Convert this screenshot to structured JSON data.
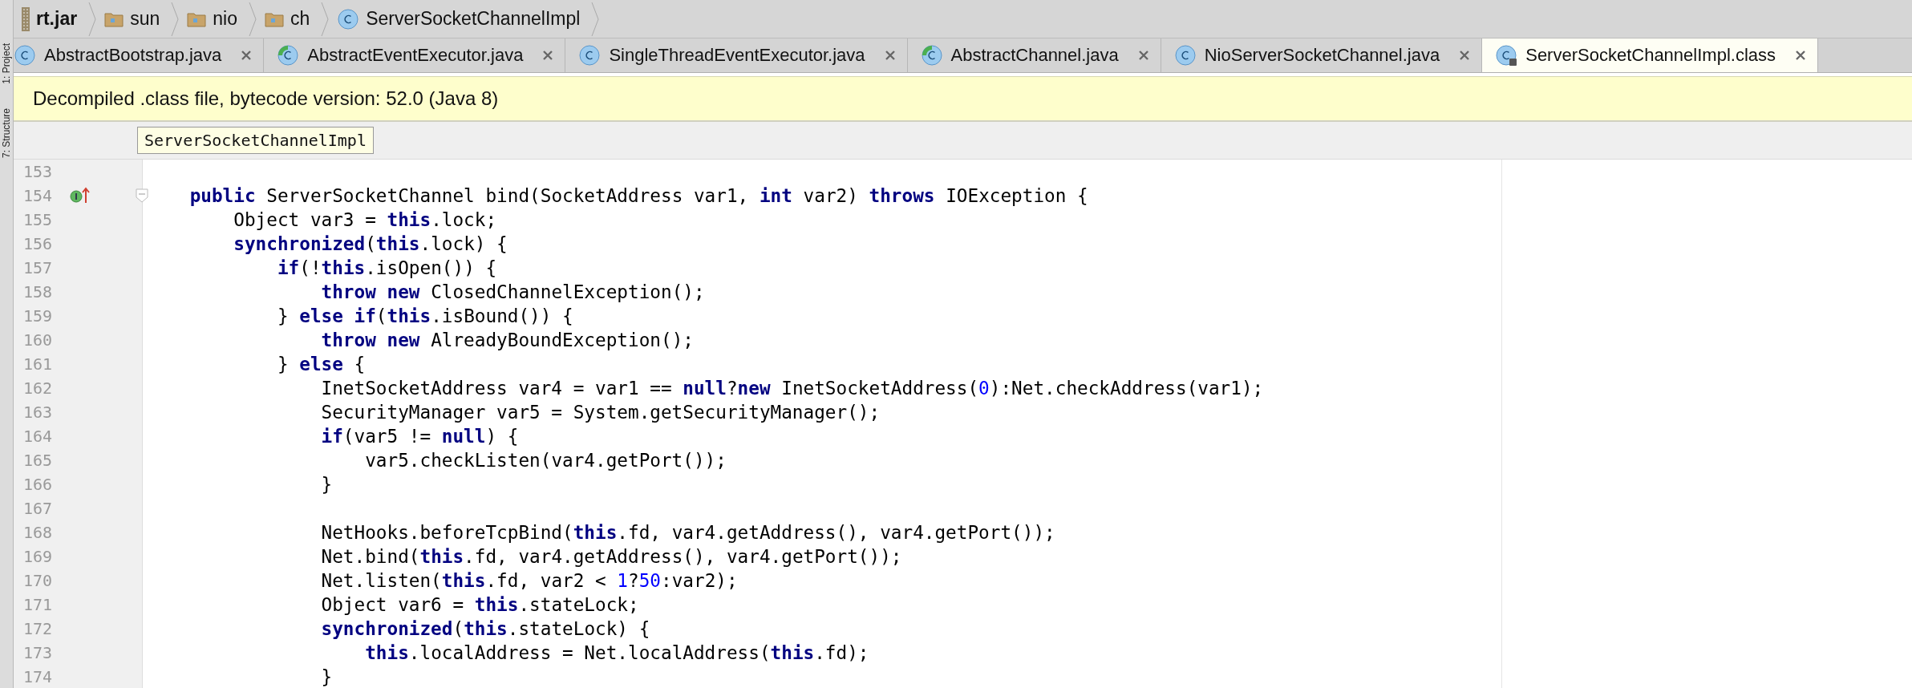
{
  "tool_strip": [
    {
      "label": "1: Project"
    },
    {
      "label": "7: Structure"
    }
  ],
  "breadcrumbs": [
    {
      "label": "rt.jar",
      "kind": "jar"
    },
    {
      "label": "sun",
      "kind": "folder"
    },
    {
      "label": "nio",
      "kind": "folder"
    },
    {
      "label": "ch",
      "kind": "folder"
    },
    {
      "label": "ServerSocketChannelImpl",
      "kind": "class"
    }
  ],
  "tabs": [
    {
      "label": "AbstractBootstrap.java",
      "kind": "class",
      "selected": false
    },
    {
      "label": "AbstractEventExecutor.java",
      "kind": "class-green",
      "selected": false
    },
    {
      "label": "SingleThreadEventExecutor.java",
      "kind": "class",
      "selected": false
    },
    {
      "label": "AbstractChannel.java",
      "kind": "class-green",
      "selected": false
    },
    {
      "label": "NioServerSocketChannel.java",
      "kind": "class",
      "selected": false
    },
    {
      "label": "ServerSocketChannelImpl.class",
      "kind": "class-locked",
      "selected": true
    }
  ],
  "banner": "Decompiled .class file, bytecode version: 52.0 (Java 8)",
  "header_hint": "ServerSocketChannelImpl",
  "lines": [
    {
      "number": "153"
    },
    {
      "number": "154",
      "kind": "implements",
      "fold": true,
      "segments": [
        {
          "kind": "keyword",
          "text": "public"
        },
        {
          "kind": "plain",
          "text": " ServerSocketChannel bind(SocketAddress var1, "
        },
        {
          "kind": "keyword",
          "text": "int"
        },
        {
          "kind": "plain",
          "text": " var2) "
        },
        {
          "kind": "keyword",
          "text": "throws"
        },
        {
          "kind": "plain",
          "text": " IOException {"
        }
      ],
      "children": [
        {
          "number": "155",
          "segments": [
            {
              "kind": "plain",
              "text": "Object var3 = "
            },
            {
              "kind": "keyword",
              "text": "this"
            },
            {
              "kind": "plain",
              "text": ".lock;"
            }
          ]
        },
        {
          "number": "156",
          "segments": [
            {
              "kind": "keyword",
              "text": "synchronized"
            },
            {
              "kind": "plain",
              "text": "("
            },
            {
              "kind": "keyword",
              "text": "this"
            },
            {
              "kind": "plain",
              "text": ".lock) {"
            }
          ],
          "children": [
            {
              "number": "157",
              "segments": [
                {
                  "kind": "keyword",
                  "text": "if"
                },
                {
                  "kind": "plain",
                  "text": "(!"
                },
                {
                  "kind": "keyword",
                  "text": "this"
                },
                {
                  "kind": "plain",
                  "text": ".isOpen()) {"
                }
              ],
              "children": [
                {
                  "number": "158",
                  "segments": [
                    {
                      "kind": "keyword",
                      "text": "throw new"
                    },
                    {
                      "kind": "plain",
                      "text": " ClosedChannelException();"
                    }
                  ]
                }
              ]
            },
            {
              "number": "159",
              "segments": [
                {
                  "kind": "plain",
                  "text": "} "
                },
                {
                  "kind": "keyword",
                  "text": "else if"
                },
                {
                  "kind": "plain",
                  "text": "("
                },
                {
                  "kind": "keyword",
                  "text": "this"
                },
                {
                  "kind": "plain",
                  "text": ".isBound()) {"
                }
              ],
              "children": [
                {
                  "number": "160",
                  "segments": [
                    {
                      "kind": "keyword",
                      "text": "throw new"
                    },
                    {
                      "kind": "plain",
                      "text": " AlreadyBoundException();"
                    }
                  ]
                }
              ]
            },
            {
              "number": "161",
              "segments": [
                {
                  "kind": "plain",
                  "text": "} "
                },
                {
                  "kind": "keyword",
                  "text": "else"
                },
                {
                  "kind": "plain",
                  "text": " {"
                }
              ],
              "children": [
                {
                  "number": "162",
                  "segments": [
                    {
                      "kind": "plain",
                      "text": "InetSocketAddress var4 = var1 == "
                    },
                    {
                      "kind": "keyword",
                      "text": "null"
                    },
                    {
                      "kind": "plain",
                      "text": "?"
                    },
                    {
                      "kind": "keyword",
                      "text": "new"
                    },
                    {
                      "kind": "plain",
                      "text": " InetSocketAddress("
                    },
                    {
                      "kind": "number",
                      "text": "0"
                    },
                    {
                      "kind": "plain",
                      "text": "):Net.checkAddress(var1);"
                    }
                  ]
                },
                {
                  "number": "163",
                  "segments": [
                    {
                      "kind": "plain",
                      "text": "SecurityManager var5 = System.getSecurityManager();"
                    }
                  ]
                },
                {
                  "number": "164",
                  "segments": [
                    {
                      "kind": "keyword",
                      "text": "if"
                    },
                    {
                      "kind": "plain",
                      "text": "(var5 != "
                    },
                    {
                      "kind": "keyword",
                      "text": "null"
                    },
                    {
                      "kind": "plain",
                      "text": ") {"
                    }
                  ],
                  "children": [
                    {
                      "number": "165",
                      "segments": [
                        {
                          "kind": "plain",
                          "text": "var5.checkListen(var4.getPort());"
                        }
                      ]
                    }
                  ]
                },
                {
                  "number": "166",
                  "segments": [
                    {
                      "kind": "plain",
                      "text": "}"
                    }
                  ]
                },
                {
                  "number": "167"
                },
                {
                  "number": "168",
                  "segments": [
                    {
                      "kind": "plain",
                      "text": "NetHooks.beforeTcpBind("
                    },
                    {
                      "kind": "keyword",
                      "text": "this"
                    },
                    {
                      "kind": "plain",
                      "text": ".fd, var4.getAddress(), var4.getPort());"
                    }
                  ]
                },
                {
                  "number": "169",
                  "segments": [
                    {
                      "kind": "plain",
                      "text": "Net.bind("
                    },
                    {
                      "kind": "keyword",
                      "text": "this"
                    },
                    {
                      "kind": "plain",
                      "text": ".fd, var4.getAddress(), var4.getPort());"
                    }
                  ]
                },
                {
                  "number": "170",
                  "segments": [
                    {
                      "kind": "plain",
                      "text": "Net.listen("
                    },
                    {
                      "kind": "keyword",
                      "text": "this"
                    },
                    {
                      "kind": "plain",
                      "text": ".fd, var2 < "
                    },
                    {
                      "kind": "number",
                      "text": "1"
                    },
                    {
                      "kind": "plain",
                      "text": "?"
                    },
                    {
                      "kind": "number",
                      "text": "50"
                    },
                    {
                      "kind": "plain",
                      "text": ":var2);"
                    }
                  ]
                },
                {
                  "number": "171",
                  "segments": [
                    {
                      "kind": "plain",
                      "text": "Object var6 = "
                    },
                    {
                      "kind": "keyword",
                      "text": "this"
                    },
                    {
                      "kind": "plain",
                      "text": ".stateLock;"
                    }
                  ]
                },
                {
                  "number": "172",
                  "segments": [
                    {
                      "kind": "keyword",
                      "text": "synchronized"
                    },
                    {
                      "kind": "plain",
                      "text": "("
                    },
                    {
                      "kind": "keyword",
                      "text": "this"
                    },
                    {
                      "kind": "plain",
                      "text": ".stateLock) {"
                    }
                  ],
                  "children": [
                    {
                      "number": "173",
                      "segments": [
                        {
                          "kind": "keyword",
                          "text": "this"
                        },
                        {
                          "kind": "plain",
                          "text": ".localAddress = Net.localAddress("
                        },
                        {
                          "kind": "keyword",
                          "text": "this"
                        },
                        {
                          "kind": "plain",
                          "text": ".fd);"
                        }
                      ]
                    }
                  ]
                },
                {
                  "number": "174",
                  "segments": [
                    {
                      "kind": "plain",
                      "text": "}"
                    }
                  ]
                }
              ]
            }
          ]
        }
      ]
    }
  ]
}
